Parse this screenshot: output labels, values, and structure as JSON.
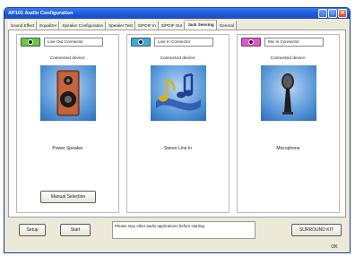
{
  "window": {
    "title": "AP101 Audio Configuration"
  },
  "title_buttons": {
    "minimize": "_",
    "restore": "□",
    "close": "✕"
  },
  "tabs": [
    {
      "label": "Sound Effect",
      "active": false
    },
    {
      "label": "Equalizer",
      "active": false
    },
    {
      "label": "Speaker Configuration",
      "active": false
    },
    {
      "label": "Speaker Test",
      "active": false
    },
    {
      "label": "S/PDIF In",
      "active": false
    },
    {
      "label": "S/PDIF Out",
      "active": false
    },
    {
      "label": "Jack Sensing",
      "active": true
    },
    {
      "label": "General",
      "active": false
    }
  ],
  "jacks": [
    {
      "connector": "Line Out Connector",
      "heading": "Connected device:",
      "device": "Power Speaker",
      "plug_color": "#5fce3e",
      "icon": "speaker-icon"
    },
    {
      "connector": "Line In Connector",
      "heading": "Connected device:",
      "device": "Stereo Line In",
      "plug_color": "#3aa9e8",
      "icon": "music-notes-icon"
    },
    {
      "connector": "Mic In Connector",
      "heading": "Connected device:",
      "device": "Microphone",
      "plug_color": "#e84fd2",
      "icon": "microphone-icon"
    }
  ],
  "manual_selection_label": "Manual Selection",
  "footer": {
    "setup_label": "Setup",
    "start_label": "Start",
    "message": "Please stop other audio applications before starting.",
    "surround_label": "SURROUND KIT"
  },
  "ok_label": "OK"
}
